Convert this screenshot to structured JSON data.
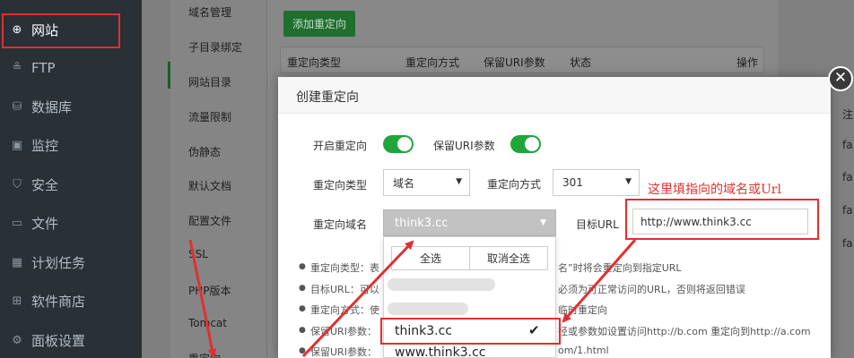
{
  "sidebar": {
    "items": [
      {
        "label": "网站",
        "icon": "globe-icon",
        "glyph": "⊕"
      },
      {
        "label": "FTP",
        "icon": "ftp-user-icon",
        "glyph": "≗"
      },
      {
        "label": "数据库",
        "icon": "database-icon",
        "glyph": "⛁"
      },
      {
        "label": "监控",
        "icon": "monitor-icon",
        "glyph": "▣"
      },
      {
        "label": "安全",
        "icon": "shield-icon",
        "glyph": "⛉"
      },
      {
        "label": "文件",
        "icon": "folder-icon",
        "glyph": "▭"
      },
      {
        "label": "计划任务",
        "icon": "calendar-icon",
        "glyph": "▦"
      },
      {
        "label": "软件商店",
        "icon": "grid-icon",
        "glyph": "⊞"
      },
      {
        "label": "面板设置",
        "icon": "gear-icon",
        "glyph": "⚙"
      }
    ]
  },
  "subnav": {
    "items": [
      "域名管理",
      "子目录绑定",
      "网站目录",
      "流量限制",
      "伪静态",
      "默认文档",
      "配置文件",
      "SSL",
      "PHP版本",
      "Tomcat",
      "重定向"
    ]
  },
  "background_panel": {
    "add_button": "添加重定向",
    "table_headers": [
      "重定向类型",
      "重定向方式",
      "保留URI参数",
      "状态",
      "操作"
    ],
    "right_texts": [
      "注",
      "fa",
      "fa",
      "fa",
      "fa"
    ]
  },
  "modal": {
    "title": "创建重定向",
    "close_glyph": "✕",
    "enable_redirect_label": "开启重定向",
    "enable_redirect_on": true,
    "keep_uri_label": "保留URI参数",
    "keep_uri_on": true,
    "redirect_type_label": "重定向类型",
    "redirect_type_value": "域名",
    "redirect_method_label": "重定向方式",
    "redirect_method_value": "301",
    "redirect_domain_label": "重定向域名",
    "redirect_domain_value": "think3.cc",
    "target_url_label": "目标URL",
    "target_url_value": "http://www.think3.cc",
    "dropdown": {
      "select_all": "全选",
      "deselect_all": "取消全选",
      "selected_option": "think3.cc",
      "option_2": "www.think3.cc"
    },
    "notes": [
      {
        "a": "重定向类型：表",
        "b": "名”时将会重定向到指定URL"
      },
      {
        "a": "目标URL：可以",
        "b": "必须为可正常访问的URL，否则将返回错误"
      },
      {
        "a": "重定向方式：使",
        "b": "临时重定向"
      },
      {
        "a": "保留URI参数：",
        "b": "径或参数如设置访问http://b.com 重定向到http://a.com"
      },
      {
        "a": "保留URI参数：",
        "b": "om/1.html"
      }
    ]
  },
  "annotation": {
    "text": "这里填指向的域名或Url",
    "color": "#e03030"
  },
  "colors": {
    "sidebar_bg": "#293036",
    "toggle_on": "#20a53a",
    "annotation_red": "#e03030"
  }
}
